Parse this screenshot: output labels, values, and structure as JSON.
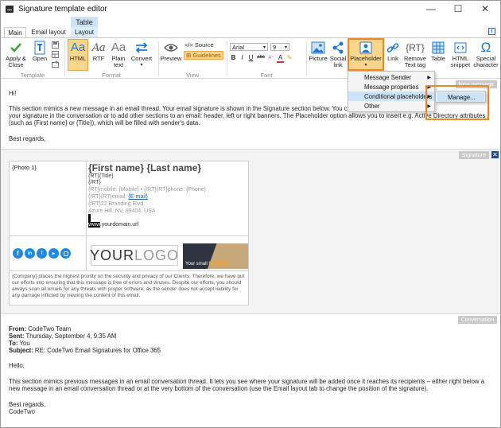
{
  "window": {
    "title": "Signature template editor",
    "minimize": "—",
    "maximize": "☐",
    "close": "✕"
  },
  "contextual_tab": "Table",
  "tabs": [
    {
      "label": "Main"
    },
    {
      "label": "Email layout"
    },
    {
      "label": "Layout"
    }
  ],
  "ribbon": {
    "apply_close": "Apply & Close",
    "open": "Open",
    "template_group": "Template",
    "html": "HTML",
    "rtf": "RTF",
    "plain_text": "Plain text",
    "convert": "Convert",
    "format_group": "Format",
    "preview": "Preview",
    "source": "</> Source",
    "guidelines": "⊞ Guidelines",
    "view_group": "View",
    "font_name": "Arial",
    "font_size": "9",
    "font_group": "Font",
    "picture": "Picture",
    "social_link": "Social link",
    "placeholder": "Placeholder",
    "link": "Link",
    "remove_text_tag": "Remove Text tag",
    "table": "Table",
    "html_snippet": "HTML snippet",
    "special_character": "Special character"
  },
  "placeholder_menu": {
    "items": [
      "Message Sender",
      "Message properties",
      "Conditional placeholders",
      "Other"
    ],
    "submenu": [
      "Manage..."
    ]
  },
  "new_message": {
    "label": "New message",
    "greeting": "Hi!",
    "paragraph_1": "This section mimics a new message in an email thread. Your email signature is shown in the Signature section below. You can specify the position of",
    "paragraph_2": "your signature in the conversation or to add other sections to an email: header, left or right banners. The Placeholder option allows you to insert e.g. Active Directory attributes",
    "paragraph_3": "(such as {First name} or {Title}), which will be filled with sender's data.",
    "closing": "Best regards,"
  },
  "signature": {
    "label": "Signature",
    "photo": "{Photo 1}",
    "name": "{First name} {Last name}",
    "title": "{RT}{Title}",
    "rt_end": "{/RT}",
    "mobile_line": "{RT}mobile: {Mobile} • {/RT}{RT}phone: {Phone}",
    "email_prefix": "{/RT}{RT}email: ",
    "email": "{E-mail}",
    "address_1": "{/RT}22 Branding Blvd.",
    "address_2": "Azure Hill, NV, 89404, USA",
    "www": "www",
    "domain": ".yourdomain.url",
    "logo_your": "YOUR",
    "logo_logo": "LOGO",
    "banner_prefix": "Your small ",
    "banner_word": "BANNER",
    "disclaimer_1": "{Company} places the highest priority on the security and privacy of our Clients. Therefore, we have put",
    "disclaimer_2": "our efforts into ensuring that this message is free of errors and viruses. Despite our efforts, you should",
    "disclaimer_3": "always scan all emails for any threats with proper software, as the sender does not accept liability for",
    "disclaimer_4": "any damage inflicted by viewing the content of this email."
  },
  "conversation": {
    "label": "Conversation",
    "from_label": "From:",
    "from_value": " CodeTwo Team",
    "sent_label": "Sent:",
    "sent_value": " Thursday, September 4, 9:35 AM",
    "to_label": "To:",
    "to_value": " You",
    "subject_label": "Subject:",
    "subject_value": " RE: CodeTwo Email Signatures for Office 365",
    "hello": "Hello,",
    "paragraph_1": "This section mimics previous messages in an email conversation thread. It lets you see where your signature will be added once it reaches its recipients – either right below a",
    "paragraph_2": "new message in an email conversation thread or at the very bottom of the conversation (use the Email layout tab to change the position of the signature).",
    "regards": "Best regards,",
    "signoff": "CodeTwo"
  },
  "colors": {
    "accent_blue": "#1f7ad1",
    "highlight_orange": "#fbd58a",
    "callout_orange": "#e8892a",
    "social_blue": "#1e88e5",
    "menu_selected": "#cde3f7"
  }
}
